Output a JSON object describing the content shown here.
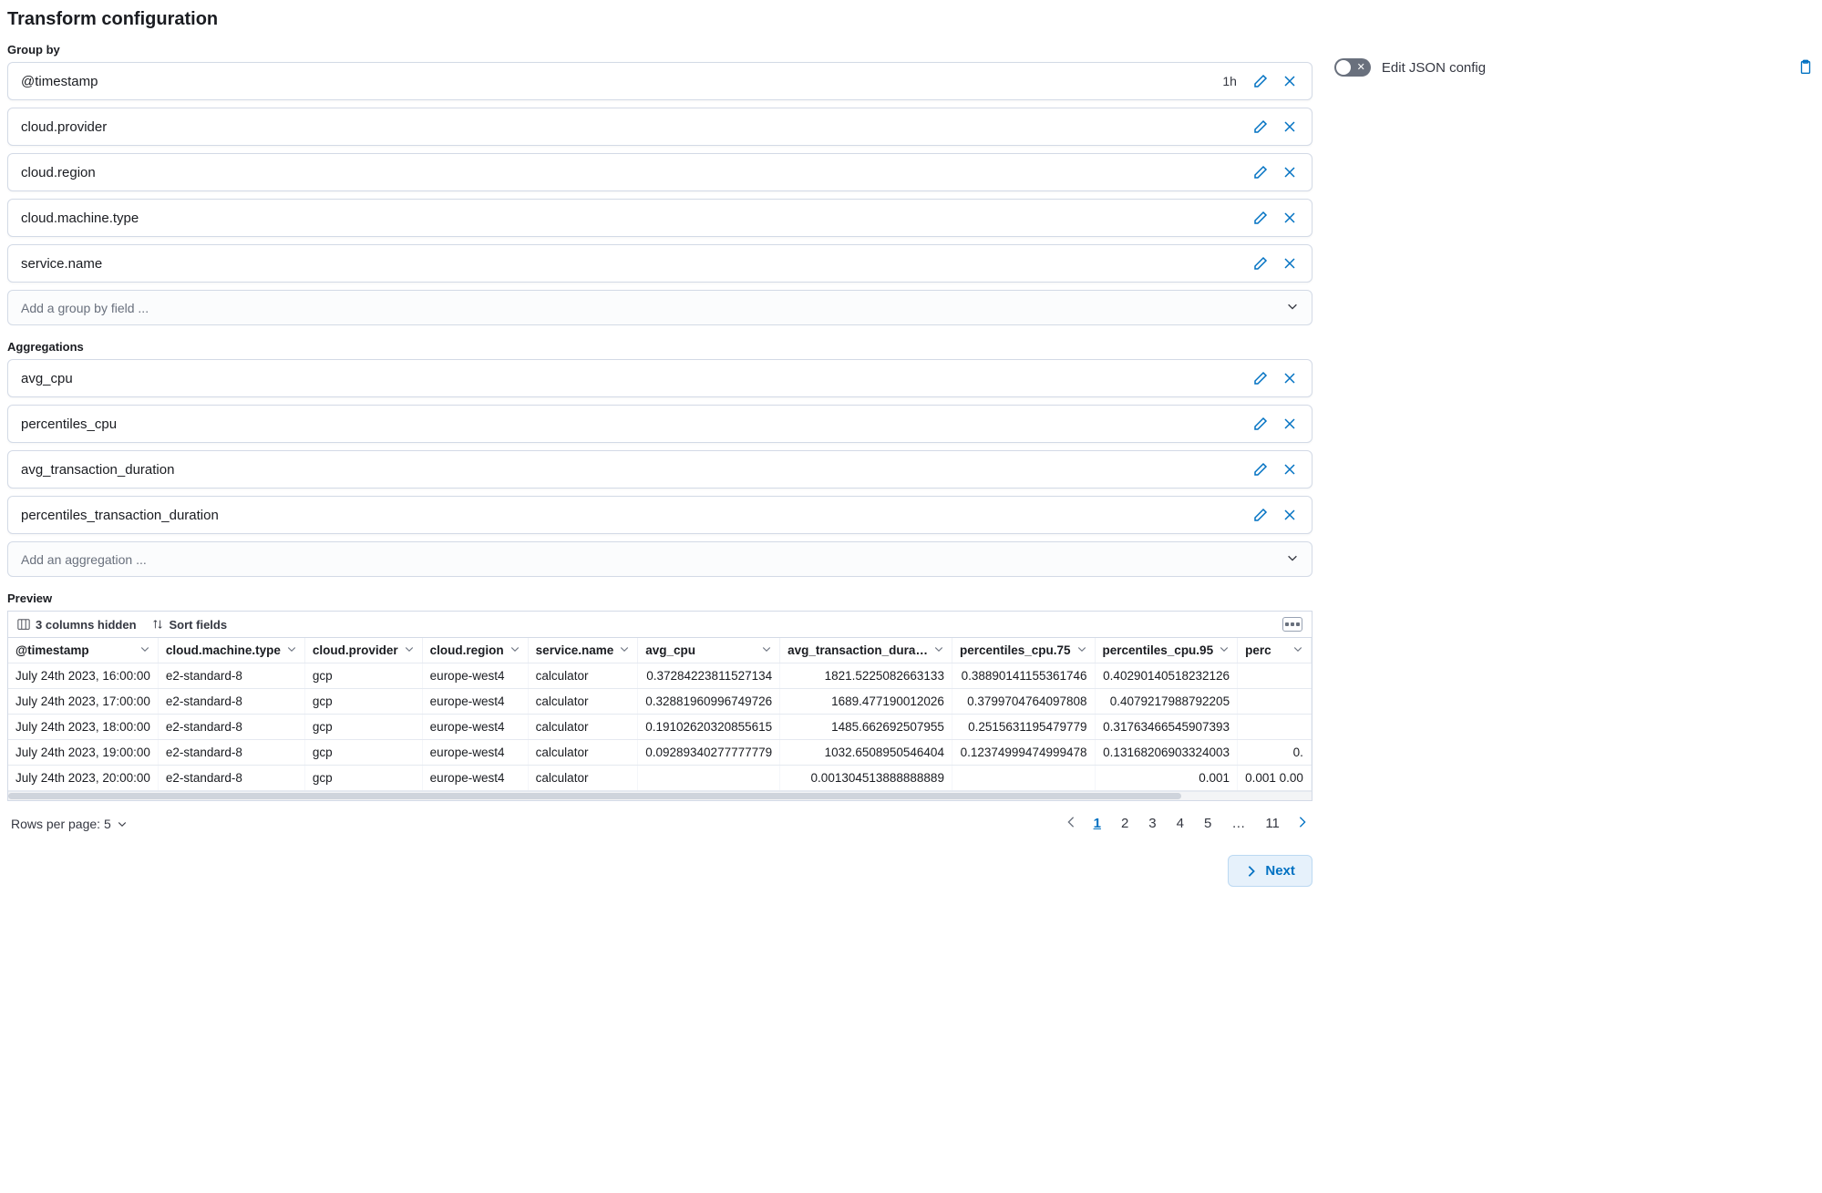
{
  "title": "Transform configuration",
  "group_by": {
    "label": "Group by",
    "items": [
      {
        "name": "@timestamp",
        "interval": "1h"
      },
      {
        "name": "cloud.provider"
      },
      {
        "name": "cloud.region"
      },
      {
        "name": "cloud.machine.type"
      },
      {
        "name": "service.name"
      }
    ],
    "add_placeholder": "Add a group by field ..."
  },
  "aggregations": {
    "label": "Aggregations",
    "items": [
      {
        "name": "avg_cpu"
      },
      {
        "name": "percentiles_cpu"
      },
      {
        "name": "avg_transaction_duration"
      },
      {
        "name": "percentiles_transaction_duration"
      }
    ],
    "add_placeholder": "Add an aggregation ..."
  },
  "side": {
    "edit_json_label": "Edit JSON config",
    "toggle_on": false
  },
  "preview": {
    "label": "Preview",
    "hidden_cols_label": "3 columns hidden",
    "sort_fields_label": "Sort fields",
    "columns": [
      {
        "key": "timestamp",
        "label": "@timestamp",
        "numeric": false
      },
      {
        "key": "machine_type",
        "label": "cloud.machine.type",
        "numeric": false
      },
      {
        "key": "provider",
        "label": "cloud.provider",
        "numeric": false
      },
      {
        "key": "region",
        "label": "cloud.region",
        "numeric": false
      },
      {
        "key": "service",
        "label": "service.name",
        "numeric": false
      },
      {
        "key": "avg_cpu",
        "label": "avg_cpu",
        "numeric": true
      },
      {
        "key": "avg_txn",
        "label": "avg_transaction_dura…",
        "numeric": true
      },
      {
        "key": "pct_cpu_75",
        "label": "percentiles_cpu.75",
        "numeric": true
      },
      {
        "key": "pct_cpu_95",
        "label": "percentiles_cpu.95",
        "numeric": true
      },
      {
        "key": "perc_extra",
        "label": "perc",
        "numeric": true
      }
    ],
    "rows": [
      {
        "timestamp": "July 24th 2023, 16:00:00",
        "machine_type": "e2-standard-8",
        "provider": "gcp",
        "region": "europe-west4",
        "service": "calculator",
        "avg_cpu": "0.37284223811527134",
        "avg_txn": "1821.5225082663133",
        "pct_cpu_75": "0.38890141155361746",
        "pct_cpu_95": "0.40290140518232126",
        "perc_extra": ""
      },
      {
        "timestamp": "July 24th 2023, 17:00:00",
        "machine_type": "e2-standard-8",
        "provider": "gcp",
        "region": "europe-west4",
        "service": "calculator",
        "avg_cpu": "0.32881960996749726",
        "avg_txn": "1689.477190012026",
        "pct_cpu_75": "0.3799704764097808",
        "pct_cpu_95": "0.4079217988792205",
        "perc_extra": ""
      },
      {
        "timestamp": "July 24th 2023, 18:00:00",
        "machine_type": "e2-standard-8",
        "provider": "gcp",
        "region": "europe-west4",
        "service": "calculator",
        "avg_cpu": "0.19102620320855615",
        "avg_txn": "1485.662692507955",
        "pct_cpu_75": "0.2515631195479779",
        "pct_cpu_95": "0.31763466545907393",
        "perc_extra": ""
      },
      {
        "timestamp": "July 24th 2023, 19:00:00",
        "machine_type": "e2-standard-8",
        "provider": "gcp",
        "region": "europe-west4",
        "service": "calculator",
        "avg_cpu": "0.09289340277777779",
        "avg_txn": "1032.6508950546404",
        "pct_cpu_75": "0.12374999474999478",
        "pct_cpu_95": "0.13168206903324003",
        "perc_extra": "0."
      },
      {
        "timestamp": "July 24th 2023, 20:00:00",
        "machine_type": "e2-standard-8",
        "provider": "gcp",
        "region": "europe-west4",
        "service": "calculator",
        "avg_cpu": "",
        "avg_txn": "0.001304513888888889",
        "pct_cpu_75": "",
        "pct_cpu_95": "0.001",
        "perc_extra": "0.001  0.00"
      }
    ],
    "rows_per_page_label": "Rows per page: 5",
    "pages": [
      "1",
      "2",
      "3",
      "4",
      "5",
      "…",
      "11"
    ],
    "active_page": "1"
  },
  "next_label": "Next"
}
